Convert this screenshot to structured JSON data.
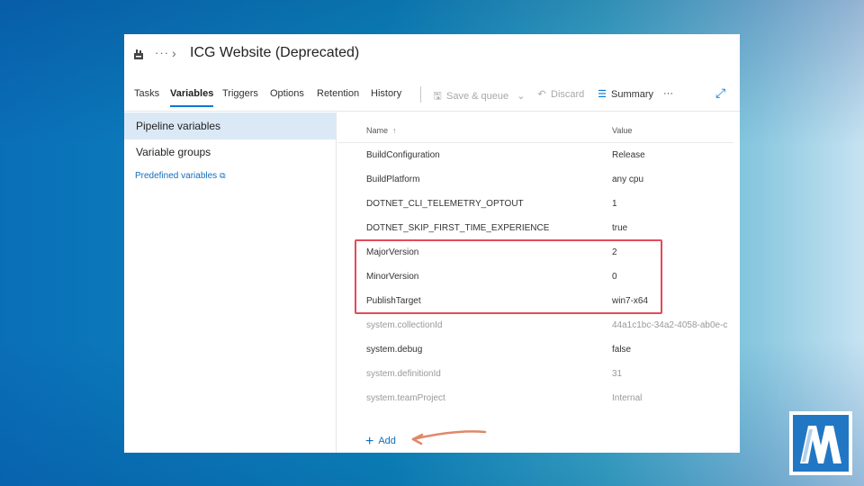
{
  "window": {
    "breadcrumb_ellipsis": "···",
    "breadcrumb_chevron": "›",
    "title": "ICG Website (Deprecated)"
  },
  "tabs": [
    {
      "label": "Tasks",
      "active": false
    },
    {
      "label": "Variables",
      "active": true
    },
    {
      "label": "Triggers",
      "active": false
    },
    {
      "label": "Options",
      "active": false
    },
    {
      "label": "Retention",
      "active": false
    },
    {
      "label": "History",
      "active": false
    }
  ],
  "toolbar": {
    "save_queue_label": "Save & queue",
    "discard_label": "Discard",
    "summary_label": "Summary",
    "more_label": "···"
  },
  "sidebar": {
    "items": [
      {
        "label": "Pipeline variables",
        "selected": true
      },
      {
        "label": "Variable groups",
        "selected": false
      }
    ],
    "link_label": "Predefined variables"
  },
  "grid": {
    "columns": {
      "name": "Name",
      "value": "Value"
    },
    "sort_arrow": "↑",
    "rows": [
      {
        "name": "BuildConfiguration",
        "value": "Release",
        "kind": "user"
      },
      {
        "name": "BuildPlatform",
        "value": "any cpu",
        "kind": "user"
      },
      {
        "name": "DOTNET_CLI_TELEMETRY_OPTOUT",
        "value": "1",
        "kind": "user"
      },
      {
        "name": "DOTNET_SKIP_FIRST_TIME_EXPERIENCE",
        "value": "true",
        "kind": "user"
      },
      {
        "name": "MajorVersion",
        "value": "2",
        "kind": "user"
      },
      {
        "name": "MinorVersion",
        "value": "0",
        "kind": "user"
      },
      {
        "name": "PublishTarget",
        "value": "win7-x64",
        "kind": "user"
      },
      {
        "name": "system.collectionId",
        "value": "44a1c1bc-34a2-4058-ab0e-c",
        "kind": "system"
      },
      {
        "name": "system.debug",
        "value": "false",
        "kind": "system-editable"
      },
      {
        "name": "system.definitionId",
        "value": "31",
        "kind": "system"
      },
      {
        "name": "system.teamProject",
        "value": "Internal",
        "kind": "system"
      }
    ],
    "add_label": "Add"
  },
  "colors": {
    "accent": "#0078d4",
    "highlight_border": "#e34b59",
    "annotation_arrow": "#e0876a",
    "logo_blue": "#2277c4"
  }
}
